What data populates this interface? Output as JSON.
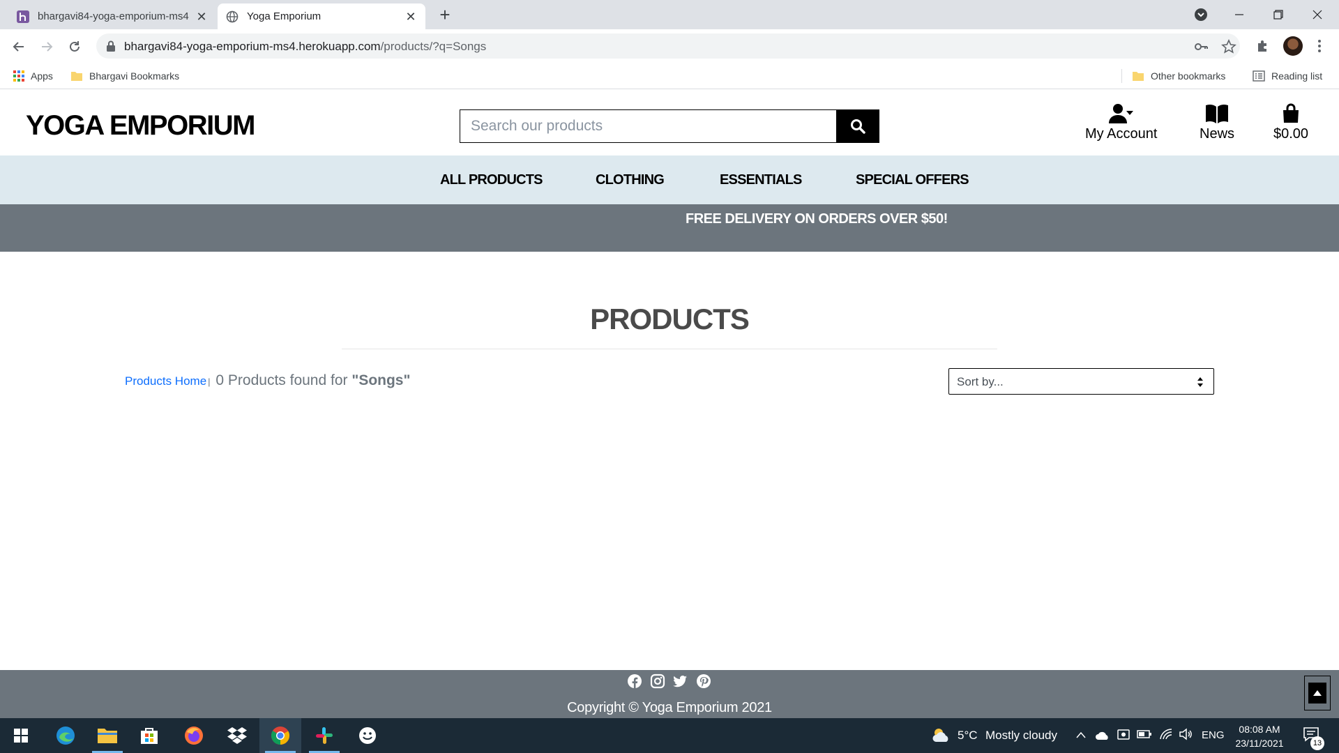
{
  "browser": {
    "tabs": [
      {
        "title": "bhargavi84-yoga-emporium-ms4",
        "active": false
      },
      {
        "title": "Yoga Emporium",
        "active": true
      }
    ],
    "url_host": "bhargavi84-yoga-emporium-ms4.herokuapp.com",
    "url_path": "/products/?q=Songs",
    "bookmarks": {
      "apps": "Apps",
      "folder": "Bhargavi Bookmarks",
      "other": "Other bookmarks",
      "reading_list": "Reading list"
    }
  },
  "site": {
    "logo": "YOGA EMPORIUM",
    "search_placeholder": "Search our products",
    "account_label": "My Account",
    "news_label": "News",
    "bag_total": "$0.00",
    "nav": [
      "ALL PRODUCTS",
      "CLOTHING",
      "ESSENTIALS",
      "SPECIAL OFFERS"
    ],
    "banner": "FREE DELIVERY ON ORDERS OVER $50!",
    "page_title": "PRODUCTS",
    "products_home": "Products Home",
    "separator": "|",
    "results_text": " 0 Products found for ",
    "search_term": "\"Songs\"",
    "sort_label": "Sort by...",
    "copyright": "Copyright © Yoga Emporium 2021",
    "social_icons": [
      "facebook-icon",
      "instagram-icon",
      "twitter-icon",
      "pinterest-icon"
    ]
  },
  "taskbar": {
    "weather_temp": "5°C",
    "weather_text": "Mostly cloudy",
    "language": "ENG",
    "time": "08:08 AM",
    "date": "23/11/2021",
    "notification_count": "13"
  },
  "colors": {
    "nav_bg": "#dde9ef",
    "banner_bg": "#6c757d",
    "link": "#0d6efd",
    "taskbar_bg": "#1b2a36"
  }
}
